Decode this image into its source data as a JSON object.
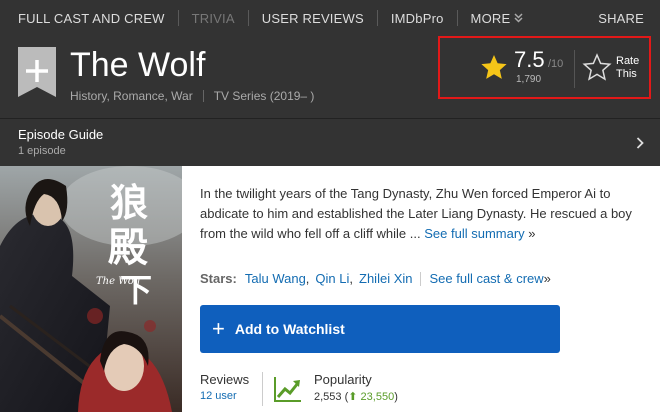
{
  "nav": {
    "items": [
      "FULL CAST AND CREW",
      "TRIVIA",
      "USER REVIEWS",
      "IMDbPro",
      "MORE"
    ],
    "share": "SHARE"
  },
  "title": {
    "name": "The Wolf",
    "genres": "History, Romance, War",
    "type": "TV Series (2019– )"
  },
  "rating": {
    "value": "7.5",
    "out_of": "/10",
    "votes": "1,790",
    "rate_label_1": "Rate",
    "rate_label_2": "This",
    "star_color": "#f5c518",
    "highlight_color": "#e21818"
  },
  "episodes": {
    "title": "Episode Guide",
    "count": "1 episode"
  },
  "poster": {
    "title_art": "The Wolf"
  },
  "summary": {
    "text": "In the twilight years of the Tang Dynasty, Zhu Wen forced Emperor Ai to abdicate to him and established the Later Liang Dynasty. He rescued a boy from the wild who fell off a cliff while ...",
    "more": "See full summary",
    "raquo": " »"
  },
  "stars": {
    "label": "Stars:",
    "names": [
      "Talu Wang",
      "Qin Li",
      "Zhilei Xin"
    ],
    "full_cast": "See full cast & crew",
    "raquo": " »"
  },
  "watchlist": {
    "plus": "+",
    "label": "Add to Watchlist",
    "color": "#0f5fbd"
  },
  "reviews": {
    "label": "Reviews",
    "user": "12 user"
  },
  "popularity": {
    "label": "Popularity",
    "rank": "2,553",
    "change": "23,550",
    "up_color": "#5a9c29"
  }
}
